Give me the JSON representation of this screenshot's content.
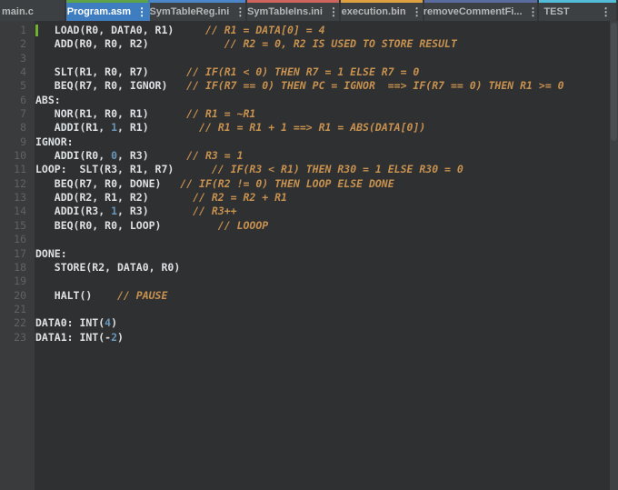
{
  "tabbar": {
    "tabs": [
      {
        "label": "main.c",
        "strip": "",
        "active": false,
        "kebab": false
      },
      {
        "label": "Program.asm",
        "strip": "#5fa348",
        "active": true,
        "kebab": true
      },
      {
        "label": "SymTableReg.ini",
        "strip": "#4a86c8",
        "active": false,
        "kebab": true
      },
      {
        "label": "SymTableIns.ini",
        "strip": "#cd655e",
        "active": false,
        "kebab": true
      },
      {
        "label": "execution.bin",
        "strip": "#dfa140",
        "active": false,
        "kebab": true
      },
      {
        "label": "removeCommentFi...",
        "strip": "#5a6ba0",
        "active": false,
        "kebab": true
      },
      {
        "label": "TEST",
        "strip": "#53bcd9",
        "active": false,
        "kebab": true
      }
    ],
    "kebab_icon": "⋮",
    "overflow_strip": "#53bcd9"
  },
  "editor": {
    "file": "Program.asm",
    "lines": [
      {
        "n": "1",
        "marker": true,
        "segs": [
          {
            "k": "c",
            "t": "   LOAD(R0, DATA0, R1)"
          },
          {
            "k": "m",
            "t": "     // R1 = DATA[0] = 4"
          }
        ]
      },
      {
        "n": "2",
        "segs": [
          {
            "k": "c",
            "t": "   ADD(R0, R0, R2)"
          },
          {
            "k": "m",
            "t": "            // R2 = 0, R2 IS USED TO STORE RESULT"
          }
        ]
      },
      {
        "n": "3",
        "segs": []
      },
      {
        "n": "4",
        "segs": [
          {
            "k": "c",
            "t": "   SLT(R1, R0, R7)"
          },
          {
            "k": "m",
            "t": "      // IF(R1 < 0) THEN R7 = 1 ELSE R7 = 0"
          }
        ]
      },
      {
        "n": "5",
        "segs": [
          {
            "k": "c",
            "t": "   BEQ(R7, R0, IGNOR)"
          },
          {
            "k": "m",
            "t": "   // IF(R7 == 0) THEN PC = IGNOR  ==> IF(R7 == 0) THEN R1 >= 0"
          }
        ]
      },
      {
        "n": "6",
        "segs": [
          {
            "k": "c",
            "t": "ABS:"
          }
        ]
      },
      {
        "n": "7",
        "segs": [
          {
            "k": "c",
            "t": "   NOR(R1, R0, R1)"
          },
          {
            "k": "m",
            "t": "      // R1 = ~R1"
          }
        ]
      },
      {
        "n": "8",
        "segs": [
          {
            "k": "c",
            "t": "   ADDI(R1, "
          },
          {
            "k": "n",
            "t": "1"
          },
          {
            "k": "c",
            "t": ", R1)"
          },
          {
            "k": "m",
            "t": "        // R1 = R1 + 1 ==> R1 = ABS(DATA[0])"
          }
        ]
      },
      {
        "n": "9",
        "segs": [
          {
            "k": "c",
            "t": "IGNOR:"
          }
        ]
      },
      {
        "n": "10",
        "segs": [
          {
            "k": "c",
            "t": "   ADDI(R0, "
          },
          {
            "k": "n",
            "t": "0"
          },
          {
            "k": "c",
            "t": ", R3)"
          },
          {
            "k": "m",
            "t": "      // R3 = 1"
          }
        ]
      },
      {
        "n": "11",
        "segs": [
          {
            "k": "c",
            "t": "LOOP:  SLT(R3, R1, R7)"
          },
          {
            "k": "m",
            "t": "      // IF(R3 < R1) THEN R30 = 1 ELSE R30 = 0"
          }
        ]
      },
      {
        "n": "12",
        "segs": [
          {
            "k": "c",
            "t": "   BEQ(R7, R0, DONE)"
          },
          {
            "k": "m",
            "t": "   // IF(R2 != 0) THEN LOOP ELSE DONE"
          }
        ]
      },
      {
        "n": "13",
        "segs": [
          {
            "k": "c",
            "t": "   ADD(R2, R1, R2)"
          },
          {
            "k": "m",
            "t": "       // R2 = R2 + R1"
          }
        ]
      },
      {
        "n": "14",
        "segs": [
          {
            "k": "c",
            "t": "   ADDI(R3, "
          },
          {
            "k": "n",
            "t": "1"
          },
          {
            "k": "c",
            "t": ", R3)"
          },
          {
            "k": "m",
            "t": "       // R3++"
          }
        ]
      },
      {
        "n": "15",
        "segs": [
          {
            "k": "c",
            "t": "   BEQ(R0, R0, LOOP)"
          },
          {
            "k": "m",
            "t": "         // LOOOP"
          }
        ]
      },
      {
        "n": "16",
        "segs": []
      },
      {
        "n": "17",
        "segs": [
          {
            "k": "c",
            "t": "DONE:"
          }
        ]
      },
      {
        "n": "18",
        "segs": [
          {
            "k": "c",
            "t": "   STORE(R2, DATA0, R0)"
          }
        ]
      },
      {
        "n": "19",
        "segs": []
      },
      {
        "n": "20",
        "segs": [
          {
            "k": "c",
            "t": "   HALT()"
          },
          {
            "k": "m",
            "t": "    // PAUSE"
          }
        ]
      },
      {
        "n": "21",
        "segs": []
      },
      {
        "n": "22",
        "segs": [
          {
            "k": "c",
            "t": "DATA0: INT("
          },
          {
            "k": "n",
            "t": "4"
          },
          {
            "k": "c",
            "t": ")"
          }
        ]
      },
      {
        "n": "23",
        "segs": [
          {
            "k": "c",
            "t": "DATA1: INT(-"
          },
          {
            "k": "n",
            "t": "2"
          },
          {
            "k": "c",
            "t": ")"
          }
        ]
      }
    ]
  },
  "colors": {
    "tabbar_bg": "#3d4042",
    "active_tab": "#3e7dc0",
    "editor_bg": "#2f3032",
    "gutter_bg": "#3a3b3d",
    "line_number": "#5d6366",
    "code_text": "#dde1e4",
    "comment_text": "#c7914f",
    "number_literal": "#6897bb",
    "change_marker": "#70b132"
  }
}
